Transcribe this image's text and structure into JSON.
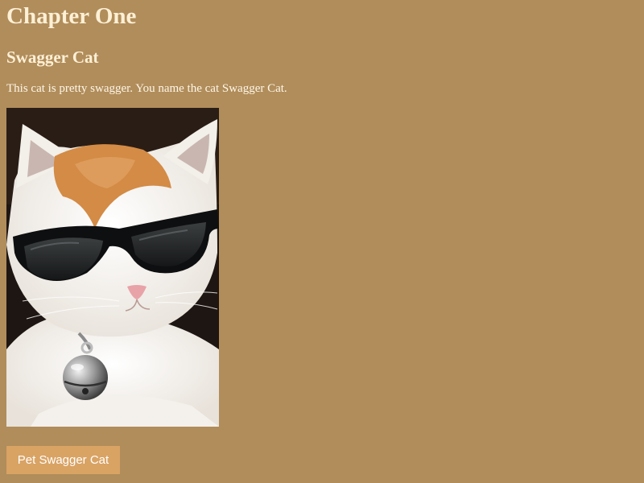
{
  "story": {
    "chapter_title": "Chapter One",
    "section_title": "Swagger Cat",
    "description": "This cat is pretty swagger. You name the cat Swagger Cat.",
    "image": {
      "icon": "cat-with-sunglasses-photo"
    },
    "action_button": {
      "label": "Pet Swagger Cat"
    }
  },
  "colors": {
    "background": "#b08d5b",
    "heading_text": "#fff0d6",
    "body_text": "#fff6e6",
    "button_background": "#d9a364",
    "button_text": "#ffffff"
  }
}
